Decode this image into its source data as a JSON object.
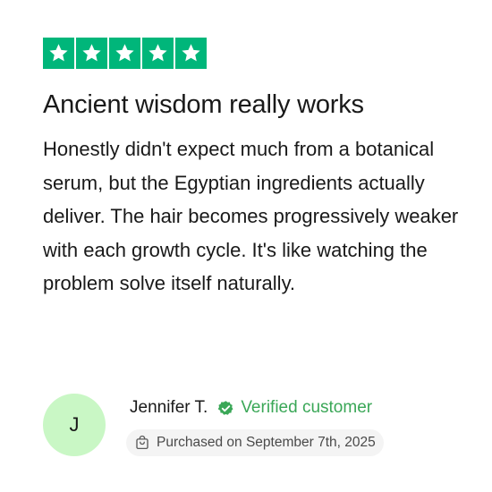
{
  "review": {
    "rating": 5,
    "rating_max": 5,
    "title": "Ancient wisdom really works",
    "body": "Honestly didn't expect much from a botanical serum, but the Egyptian ingredients actually deliver. The hair becomes progressively weaker with each growth cycle. It's like watching the problem solve itself naturally."
  },
  "reviewer": {
    "initial": "J",
    "name": "Jennifer T.",
    "verified_label": "Verified customer",
    "purchase_text": "Purchased on September 7th, 2025"
  },
  "icons": {
    "star": "star-icon",
    "verified": "verified-check-icon",
    "purchase": "shopping-bag-icon"
  },
  "colors": {
    "star_background": "#00b67a",
    "star_fill": "#ffffff",
    "verified": "#3aa757",
    "avatar_background": "#c9f7c5",
    "pill_background": "#f4f4f4"
  }
}
